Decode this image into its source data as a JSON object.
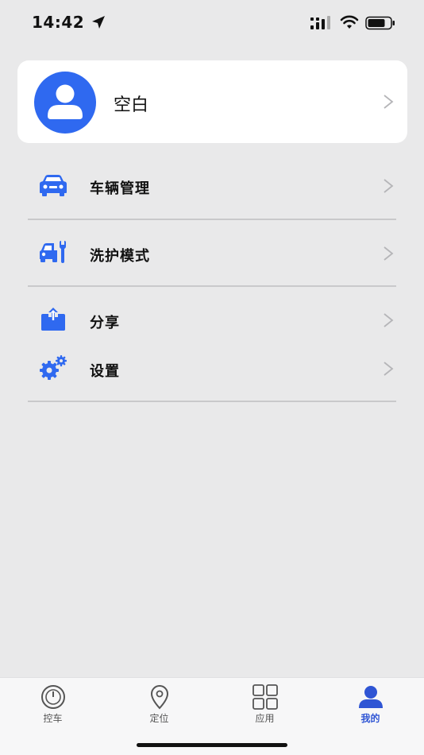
{
  "status_bar": {
    "time": "14:42"
  },
  "profile": {
    "name": "空白"
  },
  "menu": {
    "items": [
      {
        "label": "车辆管理",
        "icon": "car-icon"
      },
      {
        "label": "洗护模式",
        "icon": "car-wrench-icon"
      },
      {
        "label": "分享",
        "icon": "share-upload-icon"
      },
      {
        "label": "设置",
        "icon": "gears-icon"
      }
    ]
  },
  "tab_bar": {
    "tabs": [
      {
        "label": "控车",
        "icon": "power-icon",
        "active": false
      },
      {
        "label": "定位",
        "icon": "location-pin-icon",
        "active": false
      },
      {
        "label": "应用",
        "icon": "grid-icon",
        "active": false
      },
      {
        "label": "我的",
        "icon": "person-icon",
        "active": true
      }
    ]
  },
  "colors": {
    "accent": "#2f69f0",
    "active_tab": "#2f55d4",
    "background": "#e9e9ea"
  }
}
